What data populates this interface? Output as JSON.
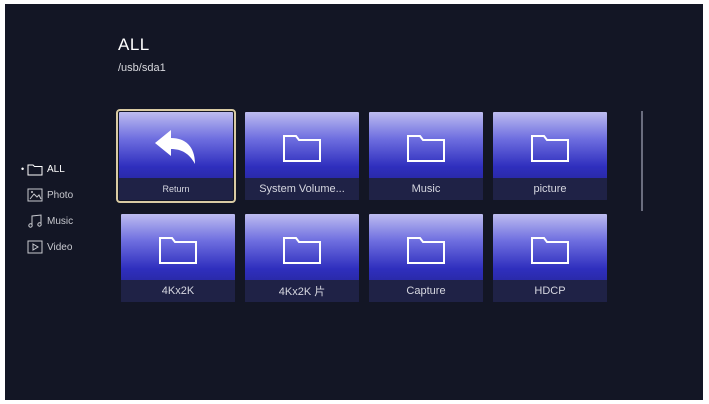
{
  "header": {
    "title": "ALL",
    "path": "/usb/sda1"
  },
  "sidebar": {
    "items": [
      {
        "label": "ALL",
        "icon": "folder-icon",
        "active": true
      },
      {
        "label": "Photo",
        "icon": "photo-icon",
        "active": false
      },
      {
        "label": "Music",
        "icon": "music-icon",
        "active": false
      },
      {
        "label": "Video",
        "icon": "video-icon",
        "active": false
      }
    ]
  },
  "grid": {
    "tiles": [
      {
        "label": "Return",
        "icon": "return-arrow-icon"
      },
      {
        "label": "System Volume...",
        "icon": "folder-icon"
      },
      {
        "label": "Music",
        "icon": "folder-icon"
      },
      {
        "label": "picture",
        "icon": "folder-icon"
      },
      {
        "label": "4Kx2K",
        "icon": "folder-icon"
      },
      {
        "label": "4Kx2K 片",
        "icon": "folder-icon"
      },
      {
        "label": "Capture",
        "icon": "folder-icon"
      },
      {
        "label": "HDCP",
        "icon": "folder-icon"
      }
    ]
  },
  "colors": {
    "background": "#131625",
    "tile_gradient_top": "#bdbcf0",
    "tile_gradient_bottom": "#202084",
    "selection_outline": "#d9cba3"
  }
}
